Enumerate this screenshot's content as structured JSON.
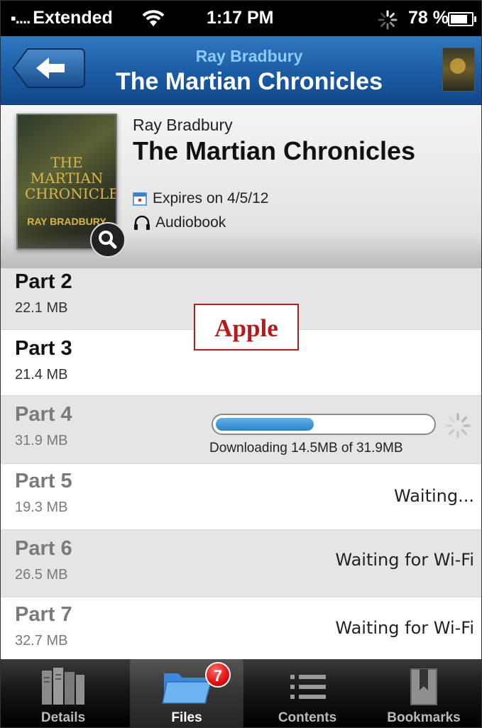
{
  "status_bar": {
    "carrier_dots": "▪....",
    "carrier": "Extended",
    "time": "1:17 PM",
    "battery": "78 %"
  },
  "nav": {
    "subtitle": "Ray Bradbury",
    "title": "The Martian Chronicles"
  },
  "book": {
    "author": "Ray Bradbury",
    "title": "The Martian Chronicles",
    "expires": "Expires on 4/5/12",
    "format": "Audiobook",
    "cover_line1": "THE MARTIAN",
    "cover_line2": "CHRONICLES",
    "cover_author": "RAY BRADBURY"
  },
  "watermark": "Apple",
  "parts": [
    {
      "name": "Part 2",
      "size": "22.1 MB",
      "status": ""
    },
    {
      "name": "Part 3",
      "size": "21.4 MB",
      "status": ""
    },
    {
      "name": "Part 4",
      "size": "31.9 MB",
      "status": "Downloading 14.5MB of 31.9MB",
      "progress": 0.455
    },
    {
      "name": "Part 5",
      "size": "19.3 MB",
      "status": "Waiting..."
    },
    {
      "name": "Part 6",
      "size": "26.5 MB",
      "status": "Waiting for Wi-Fi"
    },
    {
      "name": "Part 7",
      "size": "32.7 MB",
      "status": "Waiting for Wi-Fi"
    }
  ],
  "tabs": [
    {
      "label": "Details",
      "icon": "book-icon"
    },
    {
      "label": "Files",
      "icon": "folder-icon",
      "badge": "7",
      "active": true
    },
    {
      "label": "Contents",
      "icon": "list-icon"
    },
    {
      "label": "Bookmarks",
      "icon": "bookmark-icon"
    }
  ]
}
